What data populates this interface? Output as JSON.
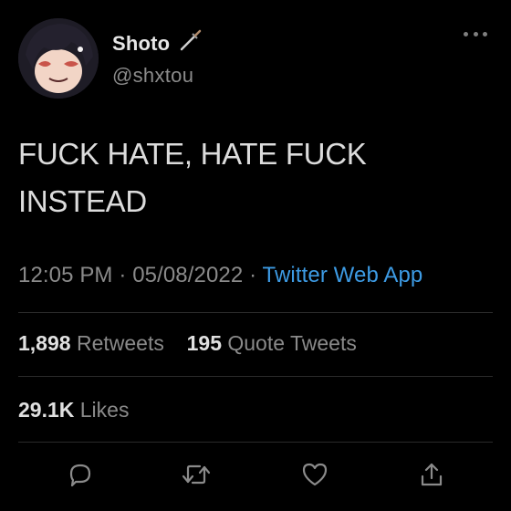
{
  "user": {
    "display_name": "Shoto",
    "handle": "@shxtou",
    "name_emoji": "dagger-icon"
  },
  "tweet": {
    "text": "FUCK HATE, HATE FUCK\nINSTEAD",
    "time": "12:05 PM",
    "date": "05/08/2022",
    "separator": "·",
    "source": "Twitter Web App"
  },
  "stats": {
    "retweets_count": "1,898",
    "retweets_label": "Retweets",
    "quote_count": "195",
    "quote_label": "Quote Tweets",
    "likes_count": "29.1K",
    "likes_label": "Likes"
  },
  "actions": [
    "reply-icon",
    "retweet-icon",
    "like-icon",
    "share-icon"
  ],
  "colors": {
    "background": "#000000",
    "link": "#3d9be4",
    "secondary_text": "#8a8a8a"
  }
}
